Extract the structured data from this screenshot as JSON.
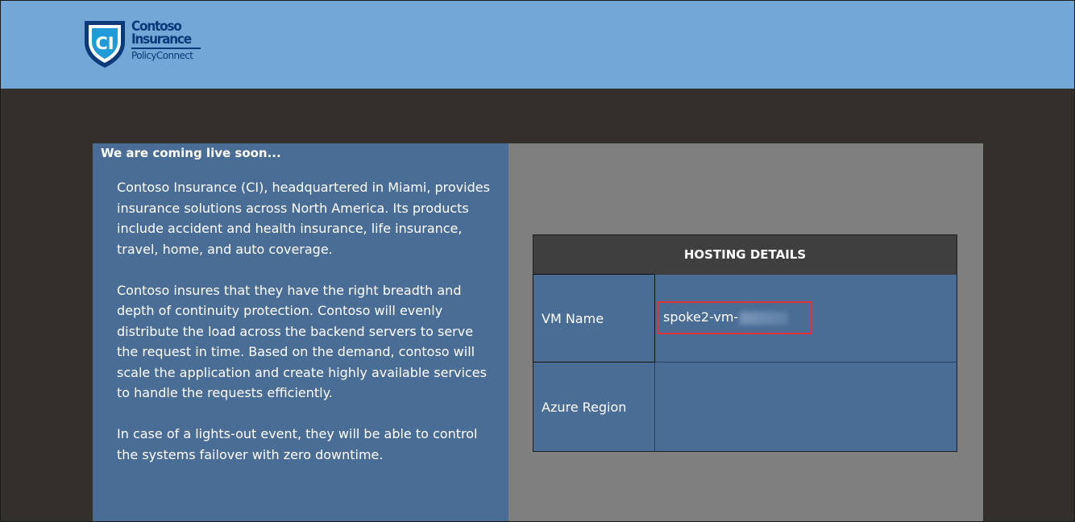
{
  "header": {
    "logo": {
      "monogram": "CI",
      "line1": "Contoso",
      "line2": "Insurance",
      "line3": "PolicyConnect"
    }
  },
  "left_panel": {
    "title": "We are coming live soon...",
    "paragraphs": [
      "Contoso Insurance (CI), headquartered in Miami, provides insurance solutions across North America. Its products include accident and health insurance, life insurance, travel, home, and auto coverage.",
      "Contoso insures that they have the right breadth and depth of continuity protection. Contoso will evenly distribute the load across the backend servers to serve the request in time. Based on the demand, contoso will scale the application and create highly available services to handle the requests efficiently.",
      "In case of a lights-out event, they will be able to control the systems failover with zero downtime."
    ]
  },
  "hosting": {
    "heading": "HOSTING DETAILS",
    "rows": [
      {
        "label": "VM Name",
        "value": "spoke2-vm-"
      },
      {
        "label": "Azure Region",
        "value": ""
      }
    ]
  },
  "colors": {
    "header_bg": "#73a7d8",
    "page_bg": "#332f2a",
    "panel_blue": "#4a6d96",
    "panel_gray": "#7f7f7f",
    "table_header": "#3f3f3f",
    "highlight": "#e0333a",
    "logo_navy": "#0c3a78"
  }
}
